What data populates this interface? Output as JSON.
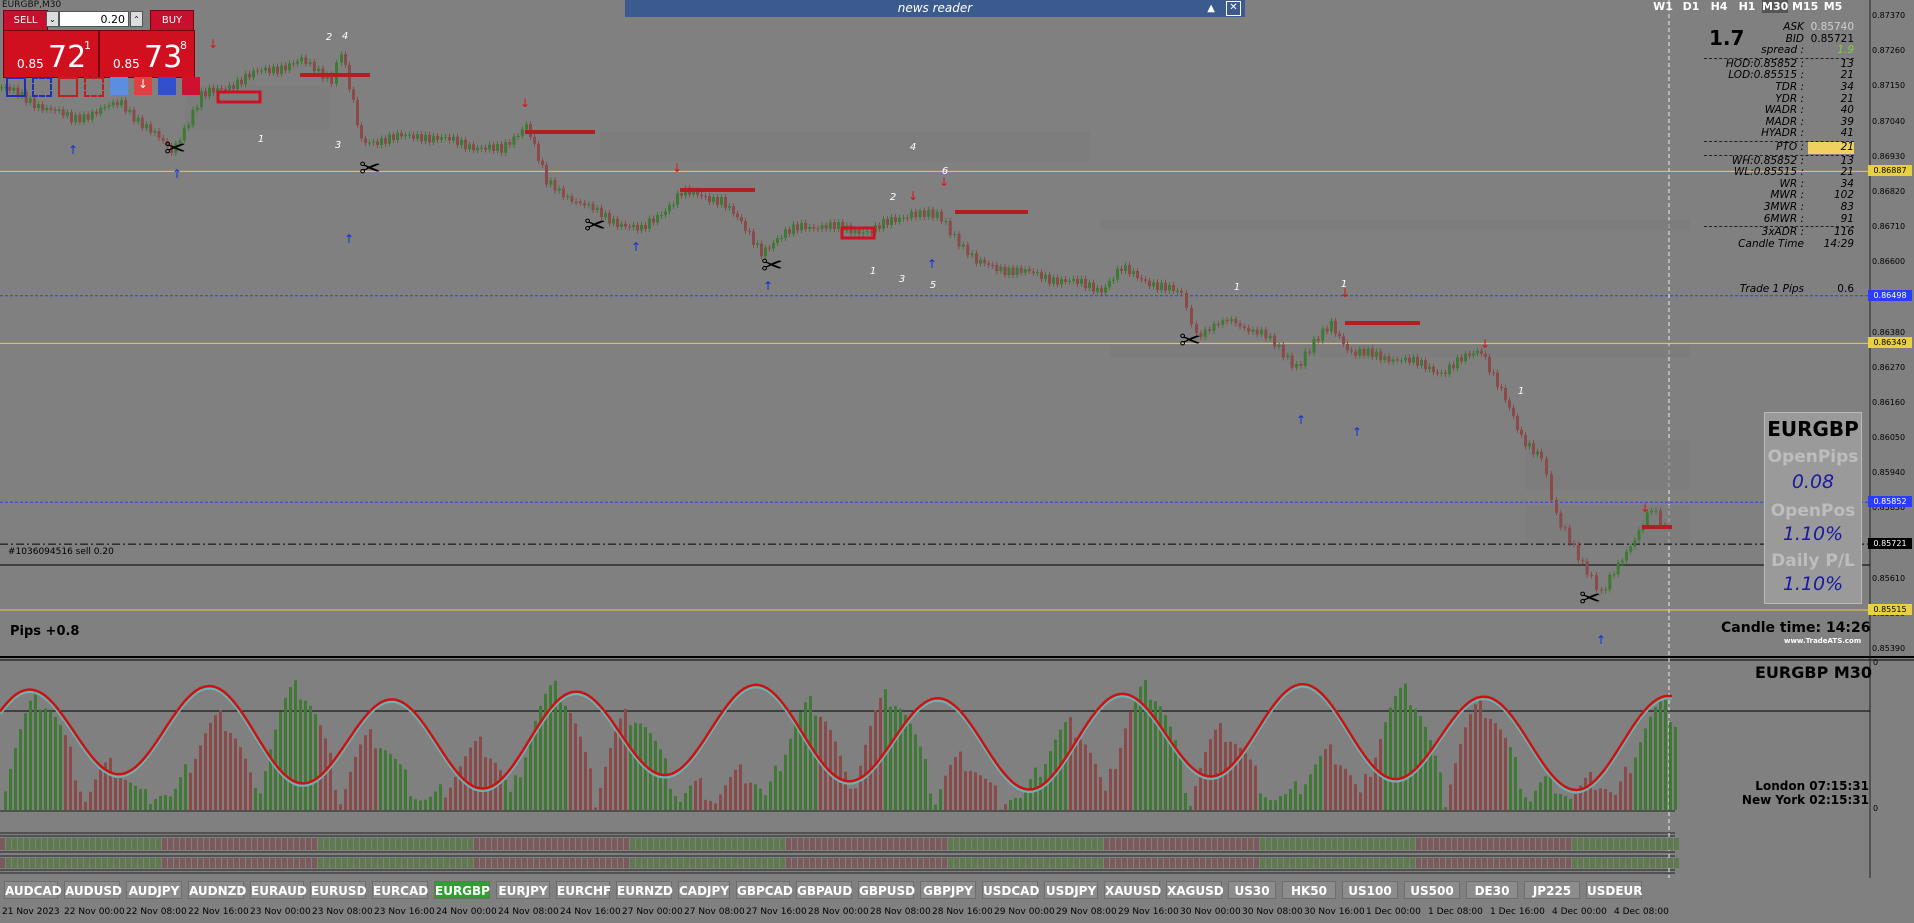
{
  "window": {
    "title": "EURGBP,M30"
  },
  "trade_panel": {
    "sell_label": "SELL",
    "buy_label": "BUY",
    "lot": "0.20",
    "bid_small": "0.85",
    "bid_big": "72",
    "bid_sup": "1",
    "ask_small": "0.85",
    "ask_big": "73",
    "ask_sup": "8"
  },
  "news": {
    "title": "news reader",
    "collapse_icon": "triangle-up",
    "close_icon": "x"
  },
  "timeframes": [
    "W1",
    "D1",
    "H4",
    "H1",
    "M30",
    "M15",
    "M5"
  ],
  "active_timeframe": "M30",
  "info_panel": {
    "big_value": "1.7",
    "rows": [
      {
        "label": "ASK",
        "value": "0.85740"
      },
      {
        "label": "BID",
        "value": "0.85721"
      },
      {
        "label": "spread :",
        "value": "1.9"
      },
      {
        "label": "HOD:0.85852 :",
        "value": "13"
      },
      {
        "label": "LOD:0.85515 :",
        "value": "21"
      },
      {
        "label": "TDR :",
        "value": "34"
      },
      {
        "label": "YDR :",
        "value": "21"
      },
      {
        "label": "WADR :",
        "value": "40"
      },
      {
        "label": "MADR :",
        "value": "39"
      },
      {
        "label": "HYADR :",
        "value": "41"
      },
      {
        "label": "PTO :",
        "value": "21"
      },
      {
        "label": "WH:0.85852 :",
        "value": "13"
      },
      {
        "label": "WL:0.85515 :",
        "value": "21"
      },
      {
        "label": "WR :",
        "value": "34"
      },
      {
        "label": "MWR :",
        "value": "102"
      },
      {
        "label": "3MWR :",
        "value": "83"
      },
      {
        "label": "6MWR :",
        "value": "91"
      },
      {
        "label": "3xADR :",
        "value": "116"
      },
      {
        "label": "Candle Time",
        "value": "14:29"
      }
    ],
    "trade_pips_label": "Trade 1 Pips",
    "trade_pips_value": "0.6"
  },
  "summary_box": {
    "symbol": "EURGBP",
    "open_pips_label": "OpenPips",
    "open_pips": "0.08",
    "open_pos_label": "OpenPos",
    "open_pos": "1.10%",
    "daily_label": "Daily P/L",
    "daily": "1.10%"
  },
  "candle_time": {
    "label": "Candle time:",
    "value": "14:26"
  },
  "pips_label": "Pips +0.8",
  "order_label": "#1036094516 sell 0.20",
  "website": "www.TradeATS.com",
  "price_axis": [
    "0.87370",
    "0.87260",
    "0.87150",
    "0.87040",
    "0.86930",
    "0.86820",
    "0.86710",
    "0.86600",
    "0.86490",
    "0.86380",
    "0.86270",
    "0.86160",
    "0.86050",
    "0.85940",
    "0.85830",
    "0.85720",
    "0.85610",
    "0.85500",
    "0.85390"
  ],
  "price_levels": [
    {
      "value": "0.86887",
      "color": "#e8d040"
    },
    {
      "value": "0.86498",
      "color": "#2a3cff"
    },
    {
      "value": "0.86349",
      "color": "#e8d040"
    },
    {
      "value": "0.85852",
      "color": "#2a3cff"
    },
    {
      "value": "0.85721",
      "color": "#000000"
    },
    {
      "value": "0.85515",
      "color": "#e8d040"
    }
  ],
  "indicator": {
    "title": "EURGBP  M30",
    "axis_top": "0",
    "axis_bottom": "0"
  },
  "clocks": [
    {
      "city": "London",
      "time": "07:15:31"
    },
    {
      "city": "New York",
      "time": "02:15:31"
    }
  ],
  "symbol_tabs": [
    "AUDCAD",
    "AUDUSD",
    "AUDJPY",
    "AUDNZD",
    "EURAUD",
    "EURUSD",
    "EURCAD",
    "EURGBP",
    "EURJPY",
    "EURCHF",
    "EURNZD",
    "CADJPY",
    "GBPCAD",
    "GBPAUD",
    "GBPUSD",
    "GBPJPY",
    "USDCAD",
    "USDJPY",
    "XAUUSD",
    "XAGUSD",
    "US30",
    "HK50",
    "US100",
    "US500",
    "DE30",
    "JP225",
    "USDEUR"
  ],
  "active_tab": "EURGBP",
  "time_axis": [
    "21 Nov 2023",
    "22 Nov 00:00",
    "22 Nov 08:00",
    "22 Nov 16:00",
    "23 Nov 00:00",
    "23 Nov 08:00",
    "23 Nov 16:00",
    "24 Nov 00:00",
    "24 Nov 08:00",
    "24 Nov 16:00",
    "27 Nov 00:00",
    "27 Nov 08:00",
    "27 Nov 16:00",
    "28 Nov 00:00",
    "28 Nov 08:00",
    "28 Nov 16:00",
    "29 Nov 00:00",
    "29 Nov 08:00",
    "29 Nov 16:00",
    "30 Nov 00:00",
    "30 Nov 08:00",
    "30 Nov 16:00",
    "1 Dec 00:00",
    "1 Dec 08:00",
    "1 Dec 16:00",
    "4 Dec 00:00",
    "4 Dec 08:00"
  ],
  "chart_labels": [
    "2",
    "4",
    "1",
    "3",
    "6",
    "4",
    "2",
    "1",
    "3",
    "5",
    "1",
    "1",
    "1"
  ],
  "colors": {
    "bull": "#3f7a35",
    "bear": "#8a4a4a",
    "osc_fast": "#cc1111",
    "osc_slow": "#6fb0b0"
  }
}
